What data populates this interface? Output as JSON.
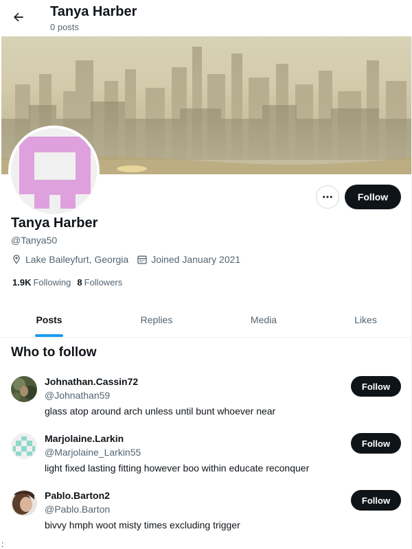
{
  "header": {
    "title": "Tanya Harber",
    "subtitle": "0 posts",
    "back_icon": "arrow-left-icon"
  },
  "profile": {
    "name": "Tanya Harber",
    "handle": "@Tanya50",
    "location": "Lake Baileyfurt, Georgia",
    "joined": "Joined January 2021",
    "following_count": "1.9K",
    "following_label": "Following",
    "followers_count": "8",
    "followers_label": "Followers",
    "follow_label": "Follow",
    "avatar_color": "#e0a1e0"
  },
  "tabs": [
    {
      "label": "Posts",
      "active": true
    },
    {
      "label": "Replies",
      "active": false
    },
    {
      "label": "Media",
      "active": false
    },
    {
      "label": "Likes",
      "active": false
    }
  ],
  "who_to_follow": {
    "title": "Who to follow",
    "items": [
      {
        "name": "Johnathan.Cassin72",
        "handle": "@Johnathan59",
        "bio": "glass atop around arch unless until bunt whoever near",
        "follow_label": "Follow"
      },
      {
        "name": "Marjolaine.Larkin",
        "handle": "@Marjolaine_Larkin55",
        "bio": "light fixed lasting fitting however boo within educate reconquer",
        "follow_label": "Follow"
      },
      {
        "name": "Pablo.Barton2",
        "handle": "@Pablo.Barton",
        "bio": "bivvy hmph woot misty times excluding trigger",
        "follow_label": "Follow"
      }
    ]
  },
  "stray_text": ":",
  "colors": {
    "accent": "#1d9bf0",
    "button_dark": "#0f1419",
    "muted_text": "#536471"
  }
}
